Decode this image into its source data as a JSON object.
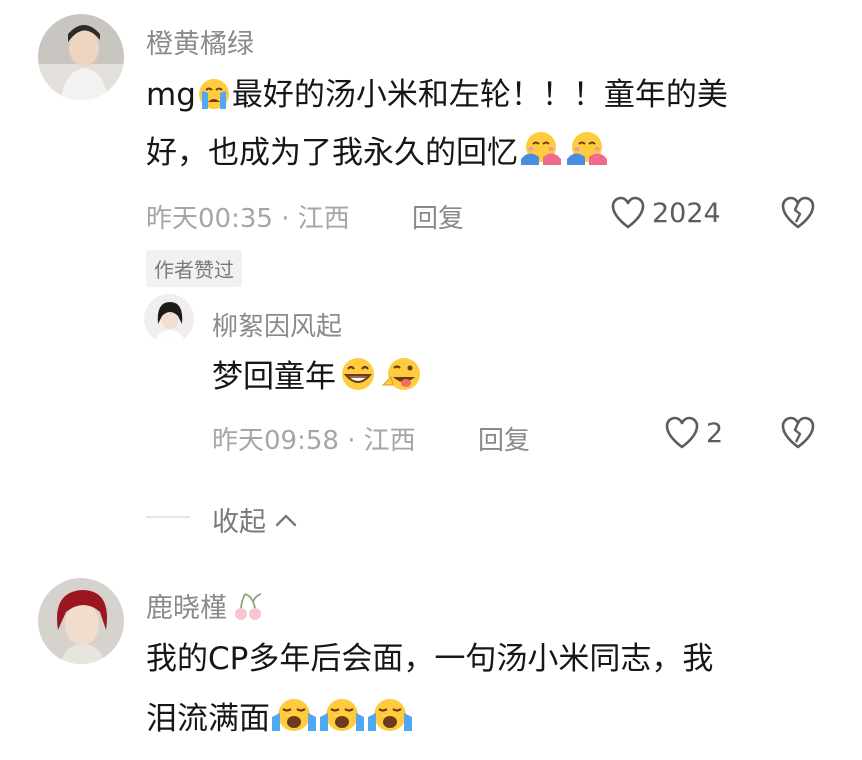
{
  "comments": [
    {
      "username": "橙黄橘绿",
      "line1_prefix": "mg",
      "line1_suffix": "最好的汤小米和左轮！！！童年的美",
      "line2": "好，也成为了我永久的回忆",
      "time": "昨天00:35",
      "location": "江西",
      "reply_label": "回复",
      "likes": "2024",
      "author_badge": "作者赞过",
      "replies": [
        {
          "username": "柳絮因风起",
          "text": "梦回童年",
          "time": "昨天09:58",
          "location": "江西",
          "reply_label": "回复",
          "likes": "2"
        }
      ],
      "collapse_label": "收起"
    },
    {
      "username": "鹿晓槿",
      "line1": "我的CP多年后会面，一句汤小米同志，我",
      "line2": "泪流满面"
    }
  ],
  "meta_separator": "·",
  "icons": {
    "like": "heart-outline-icon",
    "dislike": "broken-heart-icon",
    "collapse": "chevron-up-icon",
    "name_emoji": "cherry-icon"
  },
  "colors": {
    "text": "#161616",
    "secondary": "#8a8a8a",
    "meta": "#a6a6a6",
    "badge_bg": "#f1f1f1"
  }
}
